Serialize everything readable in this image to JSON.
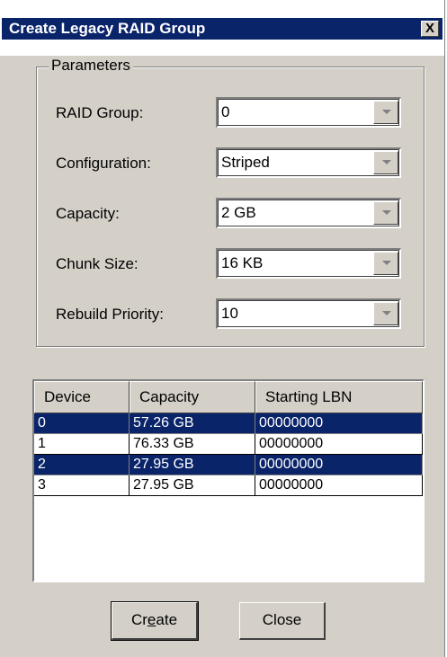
{
  "window": {
    "title": "Create Legacy RAID Group",
    "close_symbol": "X"
  },
  "parameters": {
    "legend": "Parameters",
    "fields": [
      {
        "label": "RAID Group:",
        "value": "0"
      },
      {
        "label": "Configuration:",
        "value": "Striped"
      },
      {
        "label": "Capacity:",
        "value": "2 GB"
      },
      {
        "label": "Chunk Size:",
        "value": "16 KB"
      },
      {
        "label": "Rebuild Priority:",
        "value": "10"
      }
    ]
  },
  "devices": {
    "columns": [
      "Device",
      "Capacity",
      "Starting LBN"
    ],
    "rows": [
      {
        "device": "0",
        "capacity": "57.26 GB",
        "lbn": "00000000",
        "selected": true
      },
      {
        "device": "1",
        "capacity": "76.33 GB",
        "lbn": "00000000",
        "selected": false
      },
      {
        "device": "2",
        "capacity": "27.95 GB",
        "lbn": "00000000",
        "selected": true
      },
      {
        "device": "3",
        "capacity": "27.95 GB",
        "lbn": "00000000",
        "selected": false
      }
    ]
  },
  "buttons": {
    "create_pre": "Cr",
    "create_mnemonic": "e",
    "create_post": "ate",
    "close": "Close"
  },
  "colors": {
    "title_bar": "#0a246a",
    "selection": "#0a246a",
    "dialog_face": "#d4d0c8"
  }
}
